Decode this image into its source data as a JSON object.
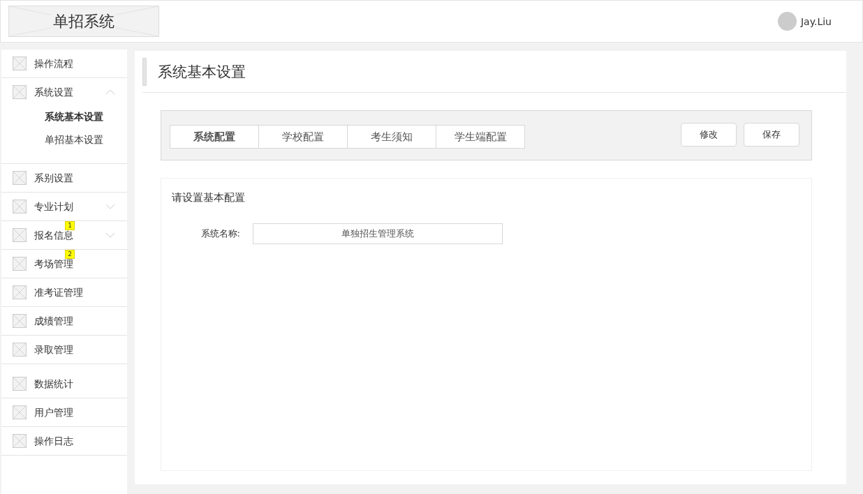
{
  "header": {
    "logo": "单招系统",
    "user": "Jay.Liu"
  },
  "sidebar": {
    "items": [
      {
        "label": "操作流程"
      },
      {
        "label": "系统设置",
        "expanded": true,
        "children": [
          {
            "label": "系统基本设置",
            "selected": true
          },
          {
            "label": "单招基本设置",
            "selected": false
          }
        ]
      },
      {
        "label": "系别设置"
      },
      {
        "label": "专业计划",
        "expanded": false
      },
      {
        "label": "报名信息",
        "expanded": false,
        "badge": "1"
      },
      {
        "label": "考场管理",
        "badge": "2"
      },
      {
        "label": "准考证管理"
      },
      {
        "label": "成绩管理"
      },
      {
        "label": "录取管理"
      },
      {
        "label": "数据统计"
      },
      {
        "label": "用户管理"
      },
      {
        "label": "操作日志"
      }
    ]
  },
  "page": {
    "title": "系统基本设置",
    "tabs": [
      {
        "label": "系统配置",
        "selected": true
      },
      {
        "label": "学校配置",
        "selected": false
      },
      {
        "label": "考生须知",
        "selected": false
      },
      {
        "label": "学生端配置",
        "selected": false
      }
    ],
    "buttons": [
      "修改",
      "保存"
    ],
    "form": {
      "heading": "请设置基本配置",
      "fields": [
        {
          "label": "系统名称:",
          "value": "单独招生管理系统"
        }
      ]
    }
  }
}
